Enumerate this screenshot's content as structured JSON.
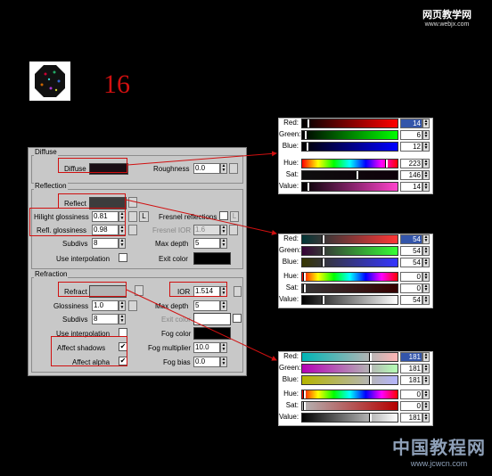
{
  "watermark_top": {
    "line1": "网页教学网",
    "line2": "www.webjx.com"
  },
  "watermark_bottom": {
    "line1": "中国教程网",
    "line2": "www.jcwcn.com"
  },
  "step_number": "16",
  "colors": {
    "annot": "#d01010",
    "panel": "#c8c8c8",
    "diffuse_swatch": "#1a0e14",
    "reflect_swatch": "#3c3c3c",
    "refract_swatch": "#b4b4b4",
    "exit_swatch": "#000000",
    "fog_swatch": "#000000",
    "refr_exit_swatch": "#ffffff"
  },
  "diffuse": {
    "title": "Diffuse",
    "diffuse_label": "Diffuse",
    "roughness_label": "Roughness",
    "roughness_value": "0.0"
  },
  "reflection": {
    "title": "Reflection",
    "reflect_label": "Reflect",
    "hilight_label": "Hilight glossiness",
    "hilight_value": "0.81",
    "l_button": "L",
    "fresnel_label": "Fresnel reflections",
    "refl_gloss_label": "Refl. glossiness",
    "refl_gloss_value": "0.98",
    "fresnel_ior_label": "Fresnel IOR",
    "fresnel_ior_value": "1.6",
    "subdivs_label": "Subdivs",
    "subdivs_value": "8",
    "max_depth_label": "Max depth",
    "max_depth_value": "5",
    "use_interp_label": "Use interpolation",
    "exit_color_label": "Exit color"
  },
  "refraction": {
    "title": "Refraction",
    "refract_label": "Refract",
    "ior_label": "IOR",
    "ior_value": "1.514",
    "glossiness_label": "Glossiness",
    "glossiness_value": "1.0",
    "max_depth_label": "Max depth",
    "max_depth_value": "5",
    "subdivs_label": "Subdivs",
    "subdivs_value": "8",
    "exit_color_label": "Exit color",
    "use_interp_label": "Use interpolation",
    "fog_color_label": "Fog color",
    "affect_shadows_label": "Affect shadows",
    "fog_mult_label": "Fog multiplier",
    "fog_mult_value": "10.0",
    "affect_alpha_label": "Affect alpha",
    "fog_bias_label": "Fog bias",
    "fog_bias_value": "0.0",
    "check_mark": "✔"
  },
  "pickers": [
    {
      "labels": {
        "red": "Red:",
        "green": "Green:",
        "blue": "Blue:",
        "hue": "Hue:",
        "sat": "Sat:",
        "value": "Value:"
      },
      "values": {
        "red": "14",
        "green": "6",
        "blue": "12",
        "hue": "223",
        "sat": "146",
        "value": "14"
      },
      "color": "#0e060c"
    },
    {
      "labels": {
        "red": "Red:",
        "green": "Green:",
        "blue": "Blue:",
        "hue": "Hue:",
        "sat": "Sat:",
        "value": "Value:"
      },
      "values": {
        "red": "54",
        "green": "54",
        "blue": "54",
        "hue": "0",
        "sat": "0",
        "value": "54"
      },
      "color": "#363636"
    },
    {
      "labels": {
        "red": "Red:",
        "green": "Green:",
        "blue": "Blue:",
        "hue": "Hue:",
        "sat": "Sat:",
        "value": "Value:"
      },
      "values": {
        "red": "181",
        "green": "181",
        "blue": "181",
        "hue": "0",
        "sat": "0",
        "value": "181"
      },
      "color": "#b5b5b5"
    }
  ]
}
